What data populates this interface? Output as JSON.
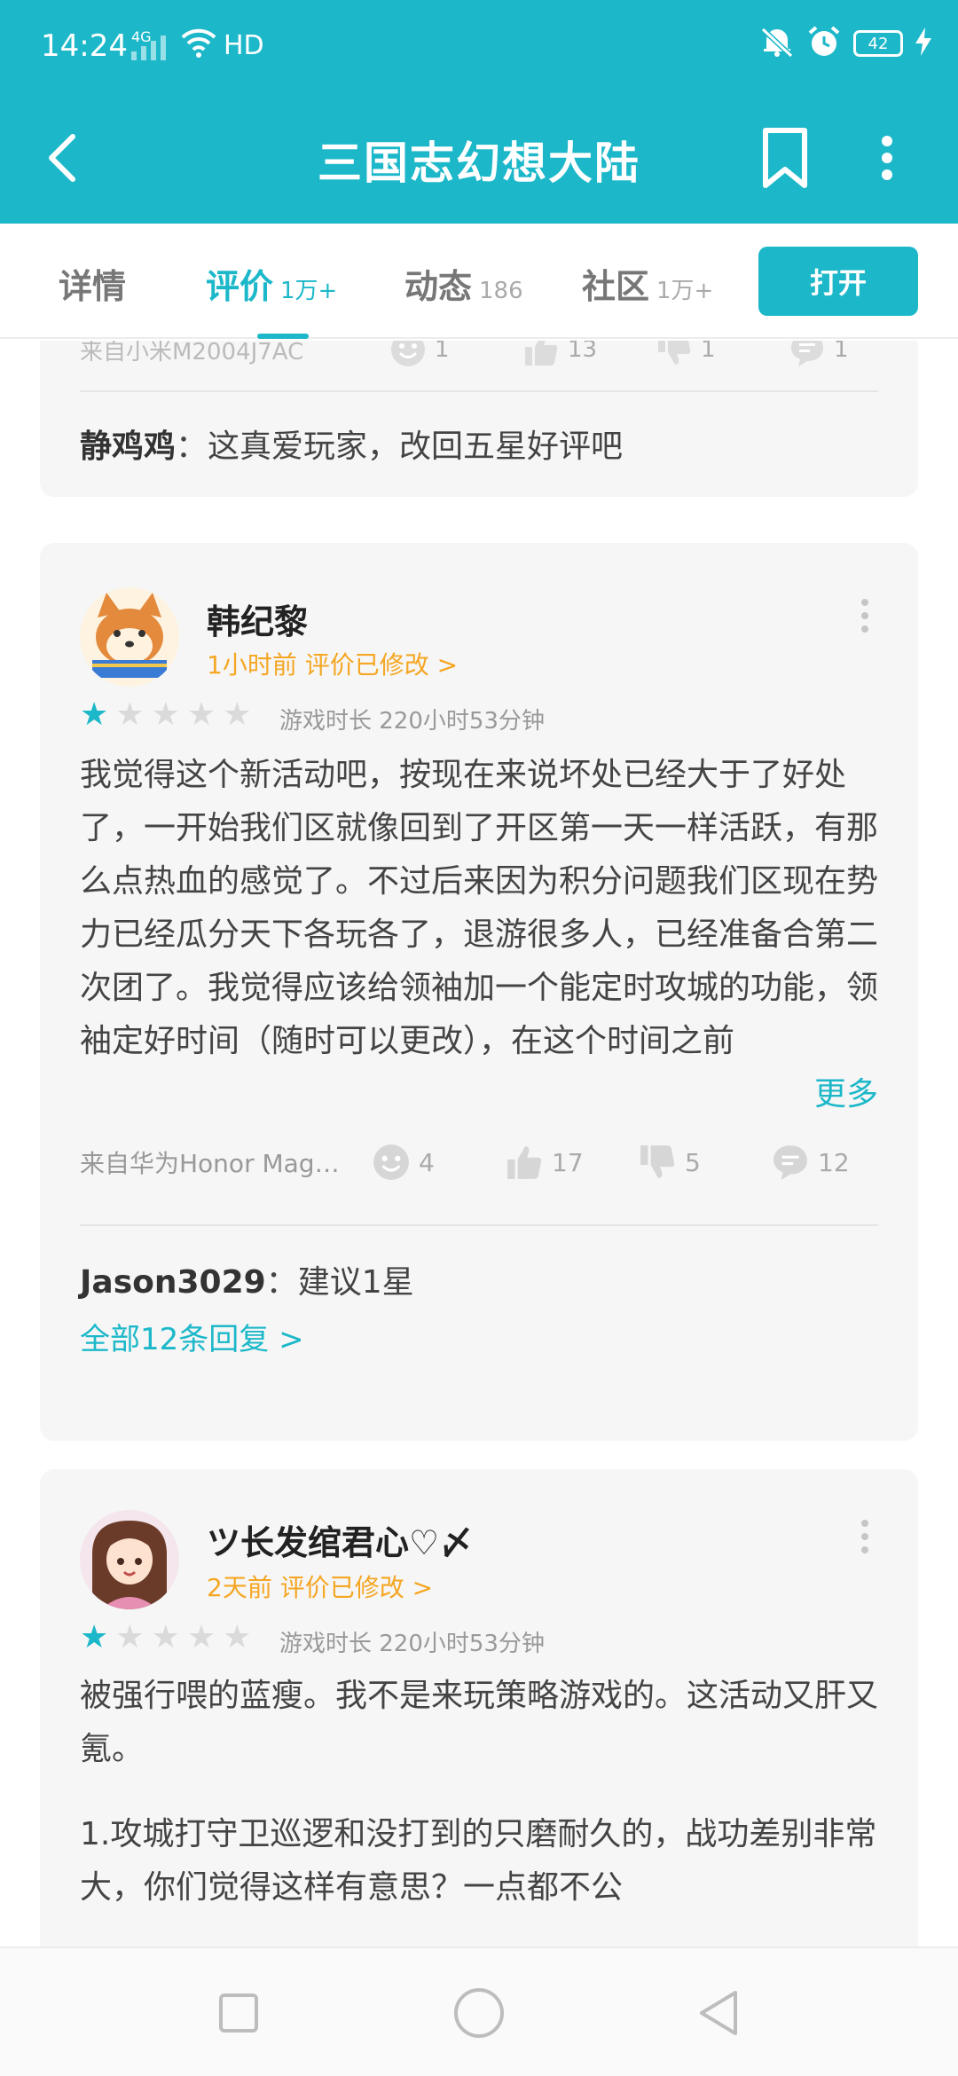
{
  "status_bar": {
    "time": "14:24",
    "network": "4G",
    "quality": "HD",
    "battery": "42"
  },
  "app_bar": {
    "title": "三国志幻想大陆"
  },
  "tabs": [
    {
      "label": "详情",
      "count": ""
    },
    {
      "label": "评价",
      "count": "1万+"
    },
    {
      "label": "动态",
      "count": "186"
    },
    {
      "label": "社区",
      "count": "1万+"
    }
  ],
  "open_button": "打开",
  "colors": {
    "accent": "#1cb8c9",
    "time_meta": "#f5a623",
    "card_bg": "#f6f6f6"
  },
  "partial_card": {
    "source": "来自小米M2004J7AC",
    "funny": "1",
    "likes": "13",
    "dislikes": "1",
    "comments": "1",
    "reply_user": "静鸡鸡",
    "reply_text": "这真爱玩家，改回五星好评吧"
  },
  "reviews": [
    {
      "username": "韩纪黎",
      "time_meta": "1小时前 评价已修改 >",
      "rating": 1,
      "playtime": "游戏时长 220小时53分钟",
      "body": "我觉得这个新活动吧，按现在来说坏处已经大于了好处了，一开始我们区就像回到了开区第一天一样活跃，有那么点热血的感觉了。不过后来因为积分问题我们区现在势力已经瓜分天下各玩各了，退游很多人，已经准备合第二次团了。我觉得应该给领袖加一个能定时攻城的功能，领袖定好时间（随时可以更改），在这个时间之前",
      "more_label": "更多",
      "source": "来自华为Honor Mag…",
      "funny": "4",
      "likes": "17",
      "dislikes": "5",
      "comments": "12",
      "reply_user": "Jason3029",
      "reply_text": "建议1星",
      "all_replies": "全部12条回复 >"
    },
    {
      "username": "ツ长发绾君心♡〆",
      "time_meta": "2天前 评价已修改 >",
      "rating": 1,
      "playtime": "游戏时长 220小时53分钟",
      "body_p1": "被强行喂的蓝瘦。我不是来玩策略游戏的。这活动又肝又氪。",
      "body_p2": "1.攻城打守卫巡逻和没打到的只磨耐久的，战功差别非常大，你们觉得这样有意思？一点都不公"
    }
  ]
}
